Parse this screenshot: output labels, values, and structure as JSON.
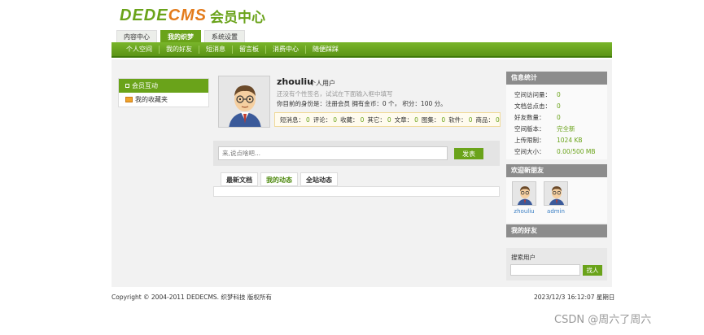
{
  "logo": {
    "en_a": "DEDE",
    "en_b": "CMS",
    "cn": "会员中心"
  },
  "top_tabs": [
    {
      "label": "内容中心",
      "active": false
    },
    {
      "label": "我的织梦",
      "active": true
    },
    {
      "label": "系统设置",
      "active": false
    }
  ],
  "nav": [
    "个人空间",
    "我的好友",
    "短消息",
    "留言板",
    "消费中心",
    "随便踩踩"
  ],
  "side_menu": [
    {
      "label": "会员互动",
      "active": true
    },
    {
      "label": "我的收藏夹",
      "active": false
    }
  ],
  "profile": {
    "username": "zhouliu",
    "user_type": "个人用户",
    "signature": "还没有个性签名，试试在下面输入框中填写",
    "identity": "你目前的身份是：注册会员 拥有金币：0 个， 积分：100 分。"
  },
  "stats": [
    {
      "label": "短消息：",
      "value": "0"
    },
    {
      "label": "评论：",
      "value": "0"
    },
    {
      "label": "收藏：",
      "value": "0"
    },
    {
      "label": "其它：",
      "value": "0"
    },
    {
      "label": "文章：",
      "value": "0"
    },
    {
      "label": "图集：",
      "value": "0"
    },
    {
      "label": "软件：",
      "value": "0"
    },
    {
      "label": "商品：",
      "value": "0"
    }
  ],
  "post": {
    "placeholder": "来,说点啥吧...",
    "button": "发表"
  },
  "content_tabs": [
    {
      "label": "最新文档",
      "active": false
    },
    {
      "label": "我的动态",
      "active": true
    },
    {
      "label": "全站动态",
      "active": false
    }
  ],
  "info_panel": {
    "title": "信息统计",
    "rows": [
      {
        "label": "空间访问量：",
        "value": "0"
      },
      {
        "label": "文档总点击：",
        "value": "0"
      },
      {
        "label": "好友数量：",
        "value": "0"
      },
      {
        "label": "空间版本：",
        "value": "完全新"
      },
      {
        "label": "上传限制：",
        "value": "1024 KB"
      },
      {
        "label": "空间大小：",
        "value": "0.00/500 MB"
      }
    ]
  },
  "new_friends": {
    "title": "欢迎新朋友",
    "items": [
      {
        "name": "zhouliu"
      },
      {
        "name": "admin"
      }
    ]
  },
  "my_friends": {
    "title": "我的好友"
  },
  "search": {
    "label": "搜索用户",
    "button": "找人"
  },
  "footer": {
    "copyright": "Copyright © 2004-2011 DEDECMS. 织梦科技 版权所有",
    "datetime": "2023/12/3 16:12:07 星期日"
  },
  "watermark": "CSDN @周六了周六",
  "colors": {
    "accent": "#6aa31a",
    "panel_head": "#8c8c8c",
    "main_bg": "#f2f2f2"
  }
}
